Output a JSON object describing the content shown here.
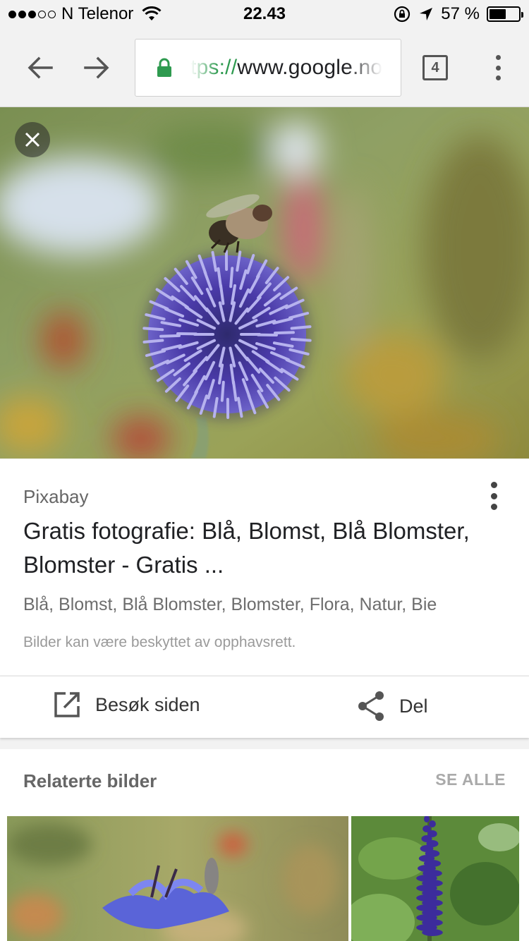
{
  "status_bar": {
    "carrier": "N Telenor",
    "time": "22.43",
    "battery_percent": "57 %",
    "battery_level": 0.57,
    "signal_bars_filled": 3,
    "signal_bars_total": 5,
    "icons": [
      "wifi-icon",
      "orientation-lock-icon",
      "location-arrow-icon",
      "battery-icon"
    ]
  },
  "toolbar": {
    "url_scheme": "tps://",
    "url_host": "www.google.no",
    "tab_count": "4",
    "icons": [
      "back-arrow-icon",
      "forward-arrow-icon",
      "lock-icon",
      "tabs-icon",
      "more-vert-icon"
    ]
  },
  "colors": {
    "lock_green": "#2e9a4f",
    "secondary_text": "#666666",
    "flower_purple": "#4a3aa8"
  },
  "result": {
    "source": "Pixabay",
    "title": "Gratis fotografie: Blå, Blomst, Blå Blomster, Blomster - Gratis ...",
    "tags": "Blå, Blomst, Blå Blomster, Blomster, Flora, Natur, Bie",
    "copyright_notice": "Bilder kan være beskyttet av opphavsrett."
  },
  "actions": {
    "visit_label": "Besøk siden",
    "share_label": "Del"
  },
  "related": {
    "title": "Relaterte bilder",
    "see_all": "SE ALLE"
  }
}
